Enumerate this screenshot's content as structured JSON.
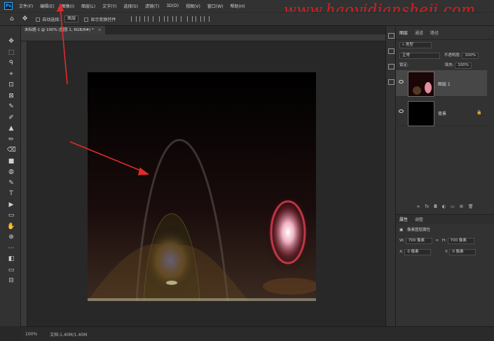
{
  "menubar": {
    "logo": "Ps",
    "items": [
      "文件(F)",
      "编辑(E)",
      "图像(I)",
      "图层(L)",
      "文字(Y)",
      "选择(S)",
      "滤镜(T)",
      "3D(D)",
      "视图(V)",
      "窗口(W)",
      "帮助(H)"
    ]
  },
  "watermark": "www.haoyidiansheji.com",
  "options": {
    "move_icon": "✥",
    "auto_select_label": "自动选择:",
    "auto_select_value": "图层",
    "transform_label": "显示变换控件"
  },
  "document_tab": {
    "title": "未标题-1 @ 100% (图层 1, RGB/8#) *",
    "close": "×"
  },
  "status": {
    "zoom": "100%",
    "doc_info": "文档:1.40M/1.40M"
  },
  "layers_panel": {
    "tabs": [
      "图层",
      "通道",
      "路径"
    ],
    "filter_kind": "类型",
    "blend_mode": "正常",
    "opacity_label": "不透明度:",
    "opacity_value": "100%",
    "lock_label": "锁定:",
    "fill_label": "填充:",
    "fill_value": "100%",
    "layers": [
      {
        "name": "图层 1",
        "selected": true
      },
      {
        "name": "背景",
        "locked": true
      }
    ],
    "footer_icons": [
      "link-icon",
      "fx-icon",
      "mask-icon",
      "adjustment-icon",
      "folder-icon",
      "new-layer-icon",
      "trash-icon"
    ],
    "footer_glyphs": [
      "∞",
      "fx",
      "◘",
      "◐",
      "▭",
      "⊞",
      "🗑"
    ]
  },
  "properties_panel": {
    "tabs": [
      "属性",
      "调整"
    ],
    "section": "像素图层属性",
    "w_label": "W:",
    "w_value": "700 像素",
    "h_label": "H:",
    "h_value": "700 像素",
    "x_label": "X:",
    "x_value": "0 像素",
    "y_label": "Y:",
    "y_value": "0 像素",
    "link_icon": "∞"
  },
  "tools": [
    "✥",
    "⬚",
    "ᑫ",
    "⌖",
    "⊡",
    "⊠",
    "✎",
    "✐",
    "▲",
    "✏",
    "⌫",
    "■",
    "◍",
    "✎",
    "T",
    "▶",
    "▭",
    "✋",
    "⊕",
    "⋯",
    "◧",
    "▭",
    "⊟"
  ],
  "tool_names": [
    "move-tool-icon",
    "marquee-tool-icon",
    "lasso-tool-icon",
    "quick-select-icon",
    "crop-tool-icon",
    "frame-tool-icon",
    "eyedropper-icon",
    "healing-brush-icon",
    "brush-tool-icon",
    "stamp-tool-icon",
    "eraser-tool-icon",
    "gradient-tool-icon",
    "blur-tool-icon",
    "pen-tool-icon",
    "type-tool-icon",
    "path-select-icon",
    "rectangle-tool-icon",
    "hand-tool-icon",
    "zoom-tool-icon",
    "more-tools-icon",
    "color-swatch-icon",
    "quick-mask-icon",
    "screen-mode-icon"
  ],
  "colors": {
    "annotation_red": "#e02a2a",
    "ps_blue": "#31a8ff"
  }
}
